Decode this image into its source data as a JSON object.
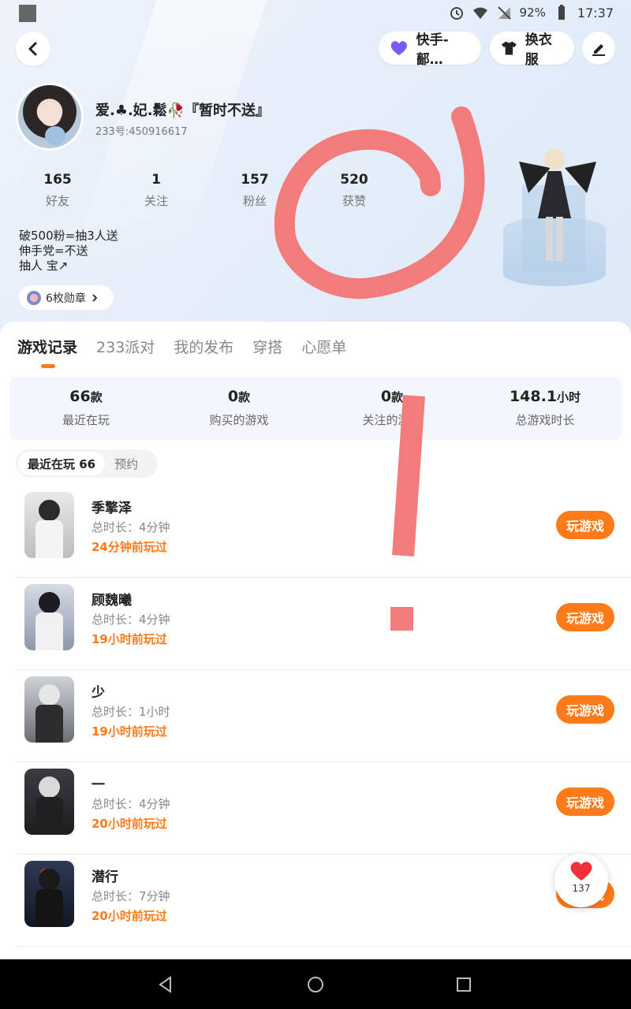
{
  "status_bar": {
    "battery": "92%",
    "time": "17:37"
  },
  "top_bar": {
    "game_pill_label": "快手-鄐…",
    "outfit_label": "换衣服"
  },
  "profile": {
    "nickname": "爱.♣.妃.鬆🥀『暂时不送』",
    "user_id": "233号:450916617",
    "stats": [
      {
        "value": "165",
        "label": "好友"
      },
      {
        "value": "1",
        "label": "关注"
      },
      {
        "value": "157",
        "label": "粉丝"
      },
      {
        "value": "520",
        "label": "获赞"
      }
    ],
    "bio": [
      "破500粉=抽3人送",
      "伸手党=不送",
      "抽人  宝↗"
    ],
    "medals_label": "6枚勋章"
  },
  "tabs": [
    "游戏记录",
    "233派对",
    "我的发布",
    "穿搭",
    "心愿单"
  ],
  "summary": [
    {
      "value": "66",
      "unit": "款",
      "label": "最近在玩"
    },
    {
      "value": "0",
      "unit": "款",
      "label": "购买的游戏"
    },
    {
      "value": "0",
      "unit": "款",
      "label": "关注的游戏"
    },
    {
      "value": "148.1",
      "unit": "小时",
      "label": "总游戏时长"
    }
  ],
  "subtabs": [
    "最近在玩 66",
    "预约"
  ],
  "games": [
    {
      "name": "季擎泽",
      "duration": "总时长：4分钟",
      "last_played": "24分钟前玩过",
      "button": "玩游戏"
    },
    {
      "name": "顾魏曦",
      "duration": "总时长：4分钟",
      "last_played": "19小时前玩过",
      "button": "玩游戏"
    },
    {
      "name": "少",
      "duration": "总时长：1小时",
      "last_played": "19小时前玩过",
      "button": "玩游戏"
    },
    {
      "name": "一",
      "duration": "总时长：4分钟",
      "last_played": "20小时前玩过",
      "button": "玩游戏"
    },
    {
      "name": "潜行",
      "duration": "总时长：7分钟",
      "last_played": "20小时前玩过",
      "button": "玩游戏"
    }
  ],
  "like_count": "137",
  "colors": {
    "accent": "#ff7a18",
    "scribble": "#f27b7b"
  }
}
